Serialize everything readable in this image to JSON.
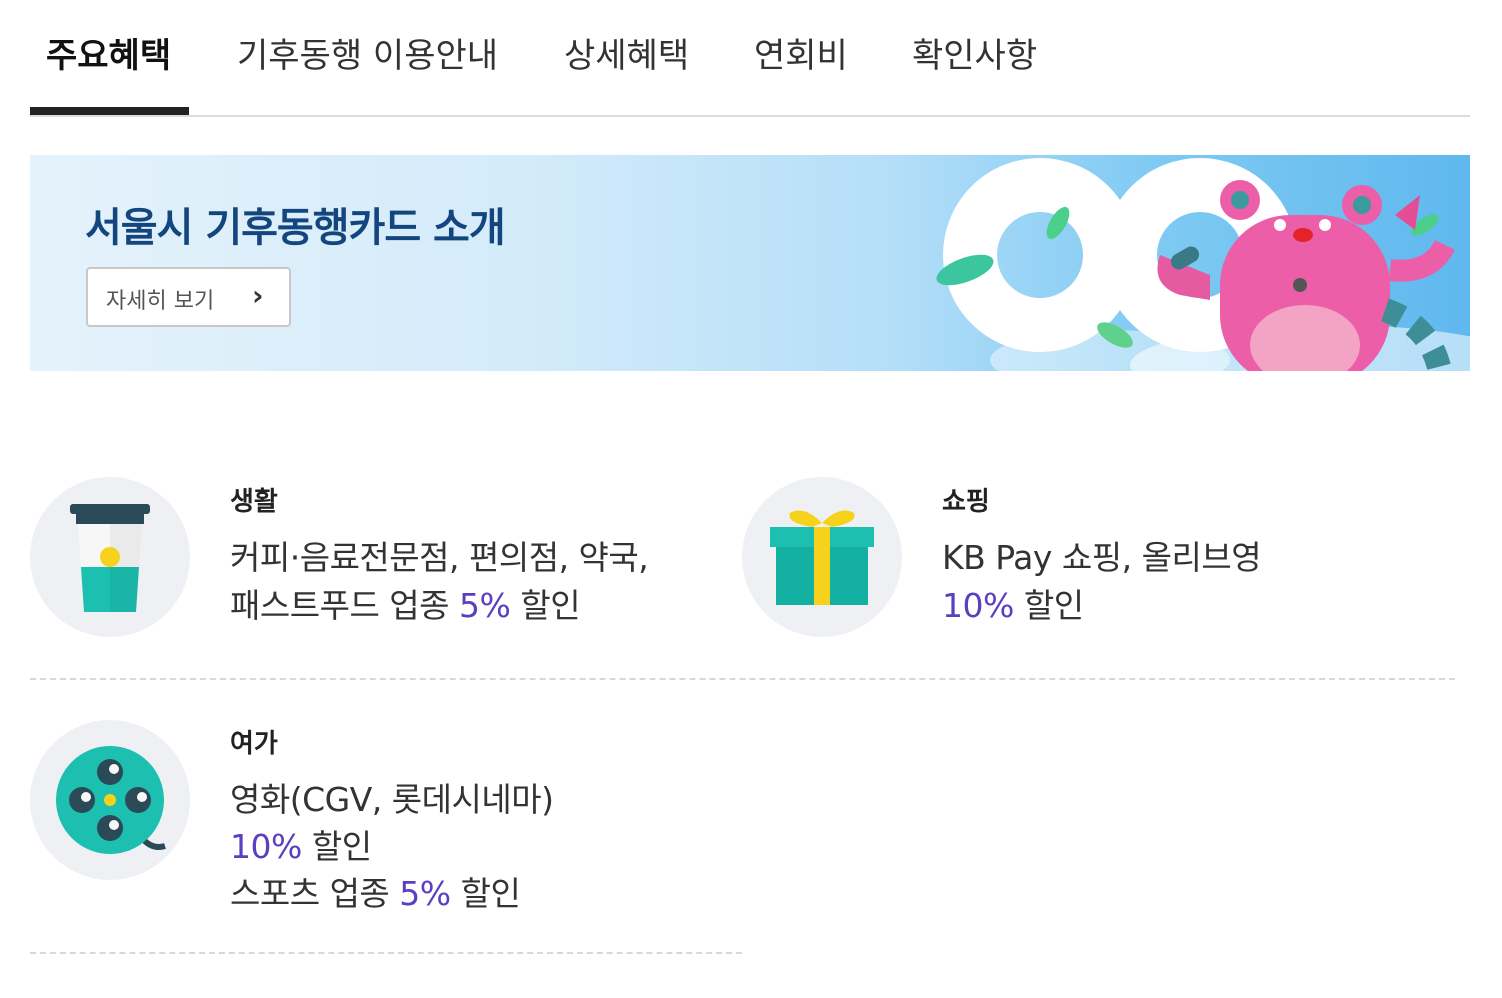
{
  "tabs": [
    {
      "label": "주요혜택"
    },
    {
      "label": "기후동행 이용안내"
    },
    {
      "label": "상세혜택"
    },
    {
      "label": "연회비"
    },
    {
      "label": "확인사항"
    }
  ],
  "banner": {
    "title": "서울시 기후동행카드 소개",
    "button_label": "자세히 보기",
    "button_icon": "chevron-right-icon"
  },
  "benefits": {
    "life": {
      "category": "생활",
      "line1": "커피·음료전문점, 편의점, 약국,",
      "line2_prefix": "패스트푸드 업종 ",
      "line2_highlight": "5%",
      "line2_suffix": " 할인",
      "icon": "coffee-cup-icon"
    },
    "shopping": {
      "category": "쇼핑",
      "line1": "KB Pay 쇼핑, 올리브영",
      "line2_highlight": "10%",
      "line2_suffix": " 할인",
      "icon": "gift-box-icon"
    },
    "leisure": {
      "category": "여가",
      "line1": "영화(CGV, 롯데시네마)",
      "line2_highlight": "10%",
      "line2_suffix": " 할인",
      "line3_prefix": "스포츠 업종 ",
      "line3_highlight": "5%",
      "line3_suffix": " 할인",
      "icon": "film-reel-icon"
    }
  },
  "colors": {
    "highlight": "#5b3fc1",
    "banner_title": "#13457e",
    "teal": "#1cbfb0",
    "gift_ribbon": "#f6d21c"
  }
}
